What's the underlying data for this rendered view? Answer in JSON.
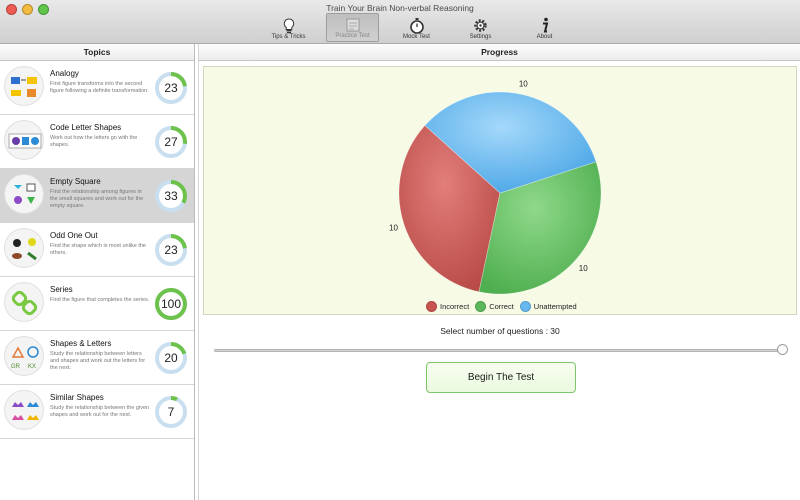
{
  "window": {
    "title": "Train Your Brain Non-verbal Reasoning"
  },
  "toolbar": {
    "items": [
      {
        "label": "Tips & Tricks",
        "icon": "lightbulb-icon"
      },
      {
        "label": "Practice Test",
        "icon": "practice-test-icon"
      },
      {
        "label": "Mock Test",
        "icon": "stopwatch-icon"
      },
      {
        "label": "Settings",
        "icon": "gear-icon"
      },
      {
        "label": "About",
        "icon": "info-icon"
      }
    ],
    "active": "Practice Test"
  },
  "topics": {
    "header": "Topics",
    "selected": "Empty Square",
    "items": [
      {
        "title": "Analogy",
        "desc": "First figure transforms into the second figure following a definite transformation.",
        "score": "23",
        "percent": 23
      },
      {
        "title": "Code Letter Shapes",
        "desc": "Work out how the letters go with the shapes.",
        "score": "27",
        "percent": 27
      },
      {
        "title": "Empty Square",
        "desc": "Find the relationship among figures in the small squares and work out for the empty square.",
        "score": "33",
        "percent": 33
      },
      {
        "title": "Odd One Out",
        "desc": "Find the shape which is most unlike the others.",
        "score": "23",
        "percent": 23
      },
      {
        "title": "Series",
        "desc": "Find the figure that completes the series.",
        "score": "100",
        "percent": 100
      },
      {
        "title": "Shapes & Letters",
        "desc": "Study the relationship between letters and shapes and work out the letters for the next.",
        "score": "20",
        "percent": 20
      },
      {
        "title": "Similar Shapes",
        "desc": "Study the relationship between the given shapes and work out for the next.",
        "score": "7",
        "percent": 7
      }
    ]
  },
  "progress": {
    "header": "Progress",
    "select_label": "Select number of questions : 30",
    "slider_value": 30,
    "slider_max": 30,
    "begin_label": "Begin The Test"
  },
  "colors": {
    "incorrect": "#c85450",
    "correct": "#5cb85c",
    "unattempted": "#66b8ee",
    "ring_fill": "#6cc24a",
    "ring_bg": "#c9dfef"
  },
  "chart_data": {
    "type": "pie",
    "categories": [
      "Incorrect",
      "Correct",
      "Unattempted"
    ],
    "values": [
      10,
      10,
      10
    ],
    "data_labels": [
      "10",
      "10",
      "10"
    ],
    "legend_position": "bottom"
  }
}
